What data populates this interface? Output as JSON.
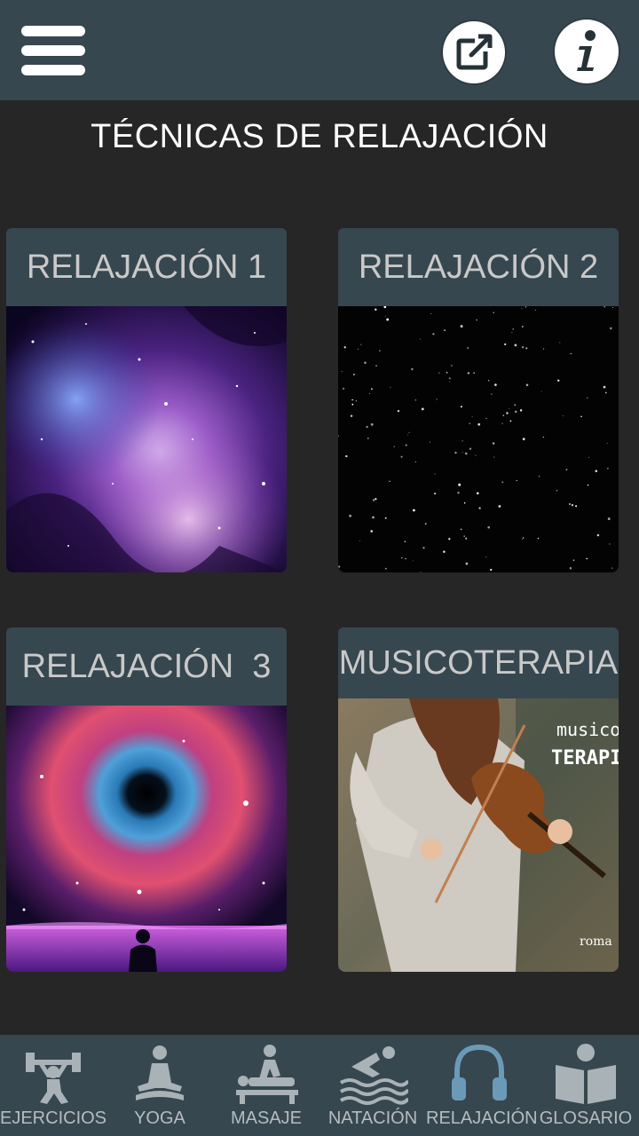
{
  "header": {
    "title": "TÉCNICAS DE RELAJACIÓN",
    "menu_icon": "hamburger-icon",
    "share_icon": "external-link-icon",
    "info_icon": "info-icon"
  },
  "cards": [
    {
      "label": "RELAJACIÓN 1",
      "image": "purple-nebula"
    },
    {
      "label": "RELAJACIÓN 2",
      "image": "starfield"
    },
    {
      "label": "RELAJACIÓN  3",
      "image": "cosmic-eye"
    },
    {
      "label": "MUSICOTERAPIA",
      "image": "violinist",
      "image_text": {
        "line1": "musico",
        "line2": "TERAPIA",
        "corner": "roma"
      }
    }
  ],
  "nav": [
    {
      "label": "EJERCICIOS",
      "icon": "weightlifter-icon"
    },
    {
      "label": "YOGA",
      "icon": "yoga-icon"
    },
    {
      "label": "MASAJE",
      "icon": "massage-icon"
    },
    {
      "label": "NATACIÓN",
      "icon": "swimmer-icon"
    },
    {
      "label": "RELAJACIÓN",
      "icon": "headphones-icon"
    },
    {
      "label": "GLOSARIO",
      "icon": "reader-icon"
    }
  ],
  "colors": {
    "bar": "#37474f",
    "background": "#262626",
    "header_text": "#c9c9c9",
    "nav_text": "#b5bcc0"
  }
}
